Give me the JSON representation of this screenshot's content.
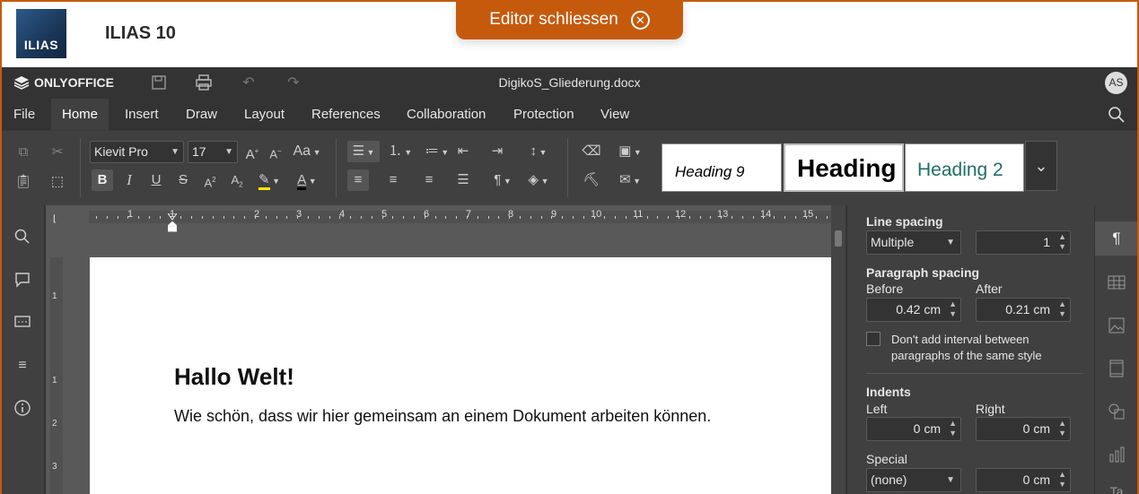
{
  "ilias": {
    "logo_text": "ILIAS",
    "title": "ILIAS 10",
    "close_editor_label": "Editor schliessen"
  },
  "onlyoffice": {
    "brand": "ONLYOFFICE",
    "document_title": "DigikoS_Gliederung.docx",
    "avatar_initials": "AS"
  },
  "menu": {
    "items": [
      "File",
      "Home",
      "Insert",
      "Draw",
      "Layout",
      "References",
      "Collaboration",
      "Protection",
      "View"
    ],
    "active": "Home"
  },
  "toolbar": {
    "font_name": "Kievit Pro",
    "font_size": "17",
    "styles": [
      "Heading 9",
      "Heading",
      "Heading 2"
    ]
  },
  "ruler": {
    "numbers": [
      "1",
      "1",
      "2",
      "3",
      "4",
      "5",
      "6",
      "7",
      "8",
      "9",
      "10",
      "11",
      "12",
      "13",
      "14",
      "15"
    ],
    "vertical_numbers": [
      "1",
      "1",
      "2",
      "3"
    ]
  },
  "document": {
    "heading": "Hallo Welt!",
    "body": "Wie schön, dass wir hier gemeinsam an einem Dokument arbeiten können."
  },
  "paragraph_settings": {
    "line_spacing_label": "Line spacing",
    "line_spacing_mode": "Multiple",
    "line_spacing_value": "1",
    "paragraph_spacing_label": "Paragraph spacing",
    "before_label": "Before",
    "before_value": "0.42 cm",
    "after_label": "After",
    "after_value": "0.21 cm",
    "checkbox_label_1": "Don't add interval between",
    "checkbox_label_2": "paragraphs of the same style",
    "indents_label": "Indents",
    "left_label": "Left",
    "left_value": "0 cm",
    "right_label": "Right",
    "right_value": "0 cm",
    "special_label": "Special",
    "special_mode": "(none)",
    "special_value": "0 cm"
  },
  "colors": {
    "ilias_orange": "#c65a0c",
    "oo_dark": "#333333",
    "oo_panel": "#404040",
    "highlight_yellow": "#ffe800",
    "heading2_teal": "#1f6f66"
  }
}
